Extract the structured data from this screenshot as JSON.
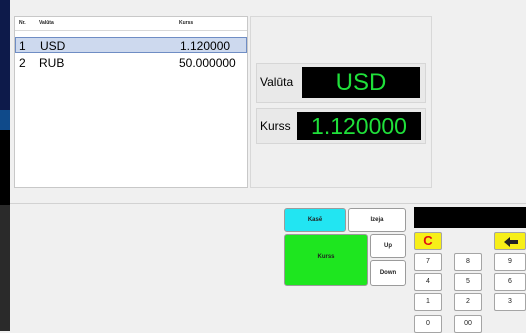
{
  "table": {
    "headers": {
      "nr": "Nr.",
      "valuta": "Valūta",
      "kurss": "Kurss"
    },
    "rows": [
      {
        "nr": "1",
        "valuta": "USD",
        "kurss": "1.120000",
        "selected": true
      },
      {
        "nr": "2",
        "valuta": "RUB",
        "kurss": "50.000000",
        "selected": false
      }
    ]
  },
  "detail": {
    "valuta_label": "Valūta",
    "valuta_value": "USD",
    "kurss_label": "Kurss",
    "kurss_value": "1.120000"
  },
  "buttons": {
    "kase": "Kasē",
    "izeja": "Izeja",
    "kurss": "Kurss",
    "up": "Up",
    "down": "Down"
  },
  "numpad": {
    "clear": "C",
    "backspace_icon": "arrow-left-icon",
    "keys": [
      "7",
      "8",
      "9",
      "4",
      "5",
      "6",
      "1",
      "2",
      "3",
      "0",
      "00"
    ]
  },
  "colors": {
    "lcd_text": "#1fe03a",
    "kase_button": "#22e5f2",
    "kurss_button": "#1ee61f",
    "numpad_yellow": "#f7ef18",
    "selected_row": "#cdd9ee"
  }
}
